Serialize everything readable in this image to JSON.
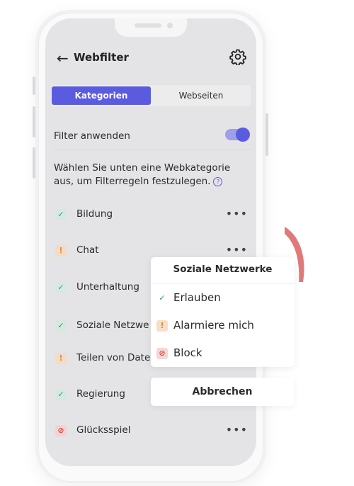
{
  "header": {
    "title": "Webfilter",
    "back_icon": "arrow-left-icon",
    "settings_icon": "gear-icon"
  },
  "tabs": [
    {
      "label": "Kategorien",
      "active": true
    },
    {
      "label": "Webseiten",
      "active": false
    }
  ],
  "filter": {
    "label": "Filter anwenden",
    "enabled": true
  },
  "description": "Wählen Sie unten eine Webkategorie aus, um Filterregeln festzulegen.",
  "categories": [
    {
      "label": "Bildung",
      "status": "allow"
    },
    {
      "label": "Chat",
      "status": "warn"
    },
    {
      "label": "Unterhaltung",
      "status": "allow"
    },
    {
      "label": "Soziale Netzwe",
      "status": "allow"
    },
    {
      "label": "Teilen von Datei",
      "status": "warn"
    },
    {
      "label": "Regierung",
      "status": "allow"
    },
    {
      "label": "Glücksspiel",
      "status": "block"
    }
  ],
  "popup": {
    "title": "Soziale Netzwerke",
    "options": [
      {
        "label": "Erlauben",
        "icon": "check-icon"
      },
      {
        "label": "Alarmiere mich",
        "icon": "exclamation-icon"
      },
      {
        "label": "Block",
        "icon": "block-icon"
      }
    ],
    "cancel_label": "Abbrechen"
  },
  "colors": {
    "accent": "#5b5be0",
    "allow": "#2e9c7a",
    "warn": "#e88a2e",
    "block": "#d94b4b",
    "decoration": "#e07a7a"
  }
}
